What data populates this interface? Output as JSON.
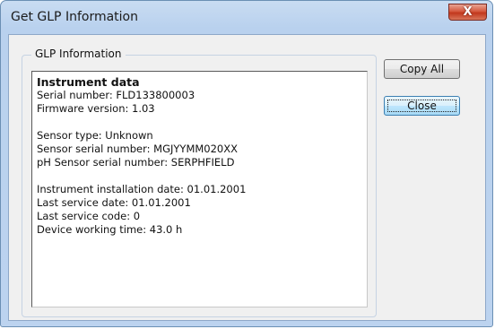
{
  "window": {
    "title": "Get GLP Information",
    "close_glyph": "X"
  },
  "group": {
    "label": "GLP Information"
  },
  "info": {
    "heading": "Instrument data",
    "lines_block1": [
      "Serial number: FLD133800003",
      "Firmware version: 1.03"
    ],
    "lines_block2": [
      "Sensor type: Unknown",
      "Sensor serial number: MGJYYMM020XX",
      "pH Sensor serial number: SERPHFIELD"
    ],
    "lines_block3": [
      "Instrument installation date: 01.01.2001",
      "Last service date: 01.01.2001",
      "Last service code: 0",
      "Device working time: 43.0 h"
    ]
  },
  "buttons": {
    "copy_all": "Copy All",
    "close": "Close"
  },
  "colors": {
    "close_button_red": "#c2381d",
    "focus_button_blue": "#3c7fb1"
  }
}
